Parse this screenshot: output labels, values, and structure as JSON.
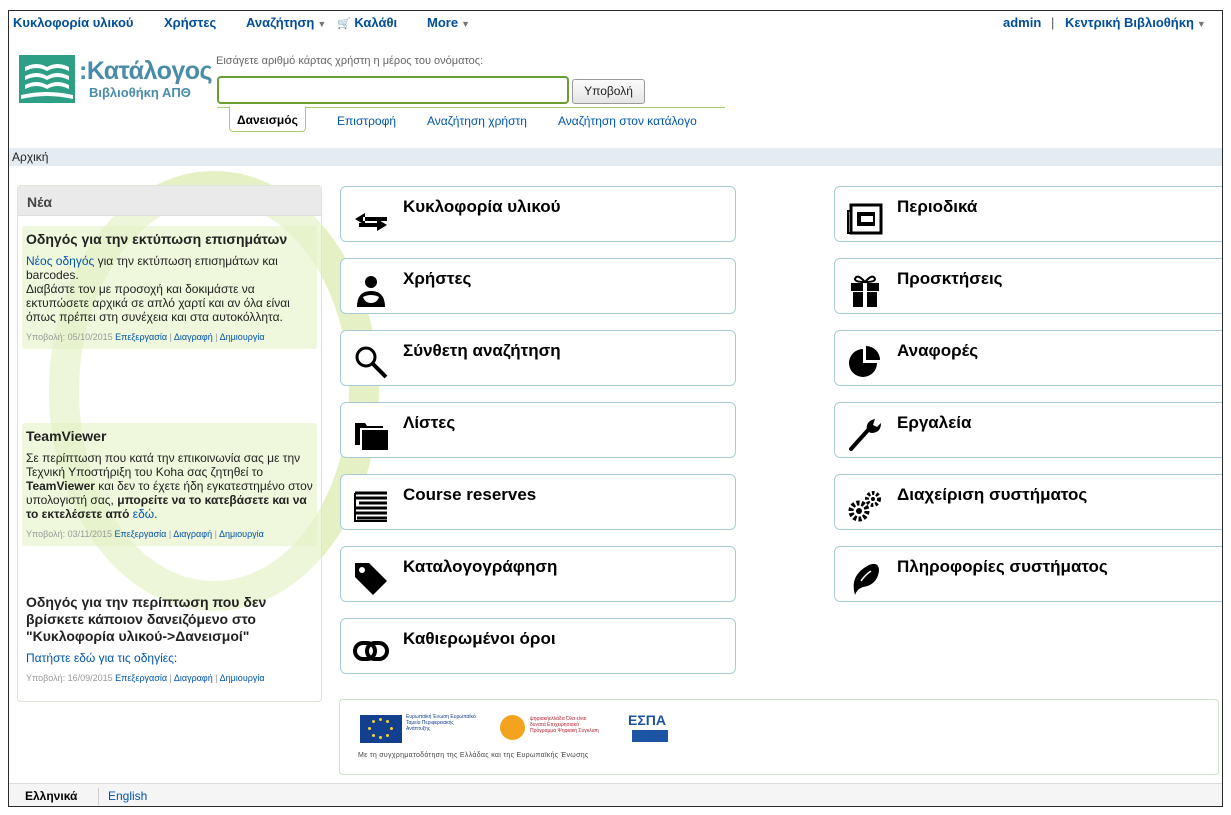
{
  "topnav": {
    "circulation": "Κυκλοφορία υλικού",
    "patrons": "Χρήστες",
    "search": "Αναζήτηση",
    "cart": "Καλάθι",
    "more": "More",
    "user": "admin",
    "separator": "|",
    "library": "Κεντρική Βιβλιοθήκη"
  },
  "logo": {
    "line1": "Κατάλογος",
    "line2": "Βιβλιοθήκη ΑΠΘ"
  },
  "search": {
    "prompt": "Εισάγετε αριθμό κάρτας χρήστη η μέρος του ονόματος:",
    "value": "",
    "submit_label": "Υποβολή",
    "tabs": [
      "Δανεισμός",
      "Επιστροφή",
      "Αναζήτηση χρήστη",
      "Αναζήτηση στον κατάλογο"
    ]
  },
  "breadcrumb": "Αρχική",
  "news": {
    "header": "Νέα",
    "items": [
      {
        "title": "Οδηγός για την εκτύπωση επισημάτων",
        "link": "Νέος οδηγός",
        "body1": " για την εκτύπωση επισημάτων και barcodes.",
        "body2": "Διαβάστε τον με προσοχή και δοκιμάστε να εκτυπώσετε αρχικά σε απλό χαρτί και αν όλα είναι όπως πρέπει στη συνέχεια και στα αυτοκόλλητα.",
        "posted": "Υποβολή: 05/10/2015",
        "edit": "Επεξεργασία",
        "delete": "Διαγραφή",
        "new": "Δημιουργία"
      },
      {
        "title": "TeamViewer",
        "body1": "Σε περίπτωση που κατά την επικοινωνία σας με την Τεχνική Υποστήριξη του Koha σας ζητηθεί το ",
        "bold1": "TeamViewer",
        "body2": " και δεν το έχετε ήδη εγκατεστημένο στον υπολογιστή σας, ",
        "bold2": "μπορείτε να το κατεβάσετε και να το εκτελέσετε από ",
        "link": "εδώ",
        "tail": ".",
        "posted": "Υποβολή: 03/11/2015",
        "edit": "Επεξεργασία",
        "delete": "Διαγραφή",
        "new": "Δημιουργία"
      },
      {
        "title": "Οδηγός για την περίπτωση που δεν βρίσκετε κάποιον δανειζόμενο στο \"Κυκλοφορία υλικού->Δανεισμοί\"",
        "link": "Πατήστε εδώ για τις οδηγίες:",
        "posted": "Υποβολή: 16/09/2015",
        "edit": "Επεξεργασία",
        "delete": "Διαγραφή",
        "new": "Δημιουργία"
      }
    ]
  },
  "tiles": {
    "left": [
      "Κυκλοφορία υλικού",
      "Χρήστες",
      "Σύνθετη αναζήτηση",
      "Λίστες",
      "Course reserves",
      "Καταλογογράφηση",
      "Καθιερωμένοι όροι"
    ],
    "right": [
      "Περιοδικά",
      "Προσκτήσεις",
      "Αναφορές",
      "Εργαλεία",
      "Διαχείριση συστήματος",
      "Πληροφορίες συστήματος"
    ]
  },
  "footer_banner": {
    "eu": "Ευρωπαϊκή Ένωση Ευρωπαϊκό Ταμείο Περιφερειακής Ανάπτυξης",
    "digital": "ψηφιακήελλάδα Όλα είναι δυνατά Επιχειρησιακό Πρόγραμμα Ψηφιακή Σύγκλιση",
    "espa": "ΕΣΠΑ",
    "caption": "Με τη συγχρηματοδότηση της Ελλάδας και της Ευρωπαϊκής Ένωσης"
  },
  "languages": {
    "current": "Ελληνικά",
    "other": "English"
  }
}
